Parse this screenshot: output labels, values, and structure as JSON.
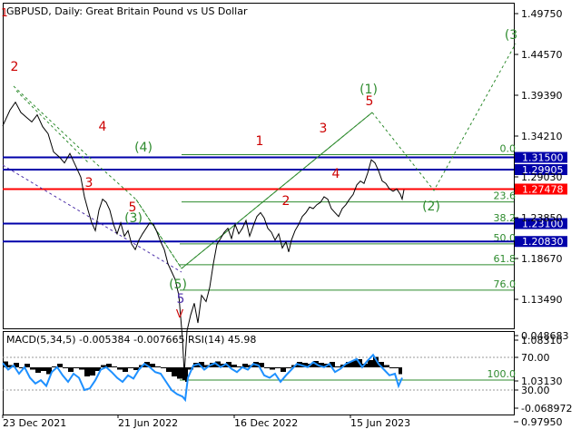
{
  "chart_data": [
    {
      "type": "line",
      "title": "GBPUSD, Daily:  Great Britain Pound vs US Dollar",
      "y_axis_ticks": [
        "1.49750",
        "1.44570",
        "1.39390",
        "1.34210",
        "1.29030",
        "1.23850",
        "1.18670",
        "1.13490",
        "1.08310",
        "1.03130",
        "0.97950"
      ],
      "x_axis_ticks": [
        "23 Dec 2021",
        "21 Jun 2022",
        "16 Dec 2022",
        "15 Jun 2023"
      ],
      "ylim": [
        0.955,
        1.51
      ],
      "price_path": [
        [
          0,
          1.355
        ],
        [
          8,
          1.375
        ],
        [
          14,
          1.385
        ],
        [
          20,
          1.372
        ],
        [
          26,
          1.366
        ],
        [
          32,
          1.36
        ],
        [
          38,
          1.369
        ],
        [
          44,
          1.354
        ],
        [
          50,
          1.345
        ],
        [
          56,
          1.322
        ],
        [
          62,
          1.316
        ],
        [
          68,
          1.308
        ],
        [
          74,
          1.32
        ],
        [
          80,
          1.305
        ],
        [
          86,
          1.29
        ],
        [
          90,
          1.265
        ],
        [
          94,
          1.248
        ],
        [
          98,
          1.232
        ],
        [
          102,
          1.222
        ],
        [
          106,
          1.248
        ],
        [
          110,
          1.262
        ],
        [
          114,
          1.258
        ],
        [
          118,
          1.248
        ],
        [
          122,
          1.23
        ],
        [
          126,
          1.218
        ],
        [
          130,
          1.232
        ],
        [
          134,
          1.215
        ],
        [
          138,
          1.222
        ],
        [
          142,
          1.205
        ],
        [
          146,
          1.198
        ],
        [
          150,
          1.21
        ],
        [
          154,
          1.218
        ],
        [
          158,
          1.225
        ],
        [
          162,
          1.232
        ],
        [
          166,
          1.23
        ],
        [
          170,
          1.22
        ],
        [
          174,
          1.208
        ],
        [
          178,
          1.198
        ],
        [
          182,
          1.18
        ],
        [
          186,
          1.17
        ],
        [
          190,
          1.16
        ],
        [
          194,
          1.14
        ],
        [
          198,
          1.085
        ],
        [
          200,
          1.04
        ],
        [
          203,
          1.095
        ],
        [
          207,
          1.115
        ],
        [
          211,
          1.13
        ],
        [
          215,
          1.105
        ],
        [
          219,
          1.14
        ],
        [
          224,
          1.132
        ],
        [
          228,
          1.15
        ],
        [
          232,
          1.18
        ],
        [
          236,
          1.205
        ],
        [
          240,
          1.212
        ],
        [
          244,
          1.22
        ],
        [
          248,
          1.225
        ],
        [
          252,
          1.212
        ],
        [
          256,
          1.23
        ],
        [
          260,
          1.218
        ],
        [
          264,
          1.225
        ],
        [
          268,
          1.235
        ],
        [
          272,
          1.215
        ],
        [
          276,
          1.228
        ],
        [
          280,
          1.24
        ],
        [
          284,
          1.245
        ],
        [
          288,
          1.238
        ],
        [
          292,
          1.225
        ],
        [
          296,
          1.22
        ],
        [
          300,
          1.21
        ],
        [
          304,
          1.218
        ],
        [
          308,
          1.2
        ],
        [
          312,
          1.208
        ],
        [
          315,
          1.195
        ],
        [
          318,
          1.21
        ],
        [
          322,
          1.222
        ],
        [
          326,
          1.23
        ],
        [
          330,
          1.24
        ],
        [
          334,
          1.245
        ],
        [
          338,
          1.252
        ],
        [
          342,
          1.25
        ],
        [
          346,
          1.255
        ],
        [
          350,
          1.258
        ],
        [
          354,
          1.265
        ],
        [
          358,
          1.262
        ],
        [
          362,
          1.25
        ],
        [
          366,
          1.245
        ],
        [
          370,
          1.24
        ],
        [
          374,
          1.25
        ],
        [
          378,
          1.255
        ],
        [
          382,
          1.262
        ],
        [
          386,
          1.268
        ],
        [
          390,
          1.28
        ],
        [
          394,
          1.285
        ],
        [
          398,
          1.282
        ],
        [
          402,
          1.295
        ],
        [
          406,
          1.312
        ],
        [
          410,
          1.308
        ],
        [
          414,
          1.298
        ],
        [
          418,
          1.285
        ],
        [
          422,
          1.282
        ],
        [
          426,
          1.275
        ],
        [
          430,
          1.272
        ],
        [
          434,
          1.275
        ],
        [
          438,
          1.268
        ],
        [
          440,
          1.262
        ],
        [
          442,
          1.274
        ]
      ],
      "levels": [
        {
          "name": "1.31500",
          "value": 1.315,
          "color": "#0000aa"
        },
        {
          "name": "1.29905",
          "value": 1.2995,
          "color": "#0000aa"
        },
        {
          "name": "1.27478",
          "value": 1.27478,
          "color": "#ff0000"
        },
        {
          "name": "1.23100",
          "value": 1.231,
          "color": "#0000aa"
        },
        {
          "name": "1.20830",
          "value": 1.2083,
          "color": "#0000aa"
        }
      ],
      "fib_levels": [
        {
          "label": "0.0",
          "value": 1.3185
        },
        {
          "label": "23.6",
          "value": 1.2585
        },
        {
          "label": "38.2",
          "value": 1.2305
        },
        {
          "label": "50.0",
          "value": 1.2052
        },
        {
          "label": "61.8",
          "value": 1.1788
        },
        {
          "label": "76.0",
          "value": 1.1465
        },
        {
          "label": "100.0",
          "value": 1.0325
        }
      ],
      "wave_labels": [
        {
          "text": "1",
          "color": "#cc0000"
        },
        {
          "text": "2",
          "color": "#cc0000"
        },
        {
          "text": "3",
          "color": "#cc0000"
        },
        {
          "text": "4",
          "color": "#cc0000"
        },
        {
          "text": "5",
          "color": "#cc0000"
        },
        {
          "text": "(3)",
          "color": "#2e8b2e"
        },
        {
          "text": "(4)",
          "color": "#2e8b2e"
        },
        {
          "text": "(5)",
          "color": "#2e8b2e"
        },
        {
          "text": "5",
          "color": "#4b2ea8"
        },
        {
          "text": "V",
          "color": "#cc0000"
        },
        {
          "text": "1",
          "color": "#cc0000"
        },
        {
          "text": "2",
          "color": "#cc0000"
        },
        {
          "text": "3",
          "color": "#cc0000"
        },
        {
          "text": "4",
          "color": "#cc0000"
        },
        {
          "text": "5",
          "color": "#cc0000"
        },
        {
          "text": "(1)",
          "color": "#2e8b2e"
        },
        {
          "text": "(2)",
          "color": "#2e8b2e"
        },
        {
          "text": "(3",
          "color": "#2e8b2e"
        }
      ]
    },
    {
      "type": "line",
      "title": "MACD(5,34,5) -0.005384 -0.007665 RSI(14) 45.98",
      "y_axis_ticks": [
        "0.048683",
        "70.00",
        "30.00",
        "-0.068972"
      ],
      "guide_levels": [
        70,
        30
      ],
      "rsi_values": [
        [
          0,
          63
        ],
        [
          6,
          55
        ],
        [
          12,
          60
        ],
        [
          18,
          50
        ],
        [
          24,
          58
        ],
        [
          30,
          45
        ],
        [
          36,
          38
        ],
        [
          42,
          42
        ],
        [
          48,
          35
        ],
        [
          54,
          52
        ],
        [
          60,
          58
        ],
        [
          66,
          48
        ],
        [
          72,
          40
        ],
        [
          78,
          50
        ],
        [
          84,
          45
        ],
        [
          90,
          30
        ],
        [
          96,
          32
        ],
        [
          102,
          42
        ],
        [
          108,
          55
        ],
        [
          114,
          58
        ],
        [
          120,
          52
        ],
        [
          126,
          45
        ],
        [
          132,
          40
        ],
        [
          138,
          48
        ],
        [
          144,
          44
        ],
        [
          150,
          55
        ],
        [
          156,
          62
        ],
        [
          162,
          58
        ],
        [
          168,
          52
        ],
        [
          174,
          50
        ],
        [
          180,
          40
        ],
        [
          186,
          30
        ],
        [
          192,
          25
        ],
        [
          198,
          22
        ],
        [
          201,
          18
        ],
        [
          204,
          45
        ],
        [
          210,
          60
        ],
        [
          216,
          62
        ],
        [
          222,
          55
        ],
        [
          228,
          60
        ],
        [
          234,
          63
        ],
        [
          240,
          58
        ],
        [
          246,
          62
        ],
        [
          252,
          56
        ],
        [
          258,
          52
        ],
        [
          264,
          58
        ],
        [
          270,
          55
        ],
        [
          276,
          62
        ],
        [
          282,
          60
        ],
        [
          288,
          48
        ],
        [
          294,
          45
        ],
        [
          300,
          50
        ],
        [
          306,
          40
        ],
        [
          312,
          48
        ],
        [
          318,
          55
        ],
        [
          324,
          62
        ],
        [
          330,
          60
        ],
        [
          336,
          58
        ],
        [
          342,
          64
        ],
        [
          348,
          60
        ],
        [
          354,
          58
        ],
        [
          360,
          62
        ],
        [
          366,
          52
        ],
        [
          372,
          56
        ],
        [
          378,
          62
        ],
        [
          384,
          65
        ],
        [
          390,
          68
        ],
        [
          396,
          58
        ],
        [
          402,
          66
        ],
        [
          408,
          73
        ],
        [
          414,
          62
        ],
        [
          420,
          55
        ],
        [
          426,
          48
        ],
        [
          432,
          50
        ],
        [
          436,
          35
        ],
        [
          440,
          45
        ]
      ]
    }
  ]
}
